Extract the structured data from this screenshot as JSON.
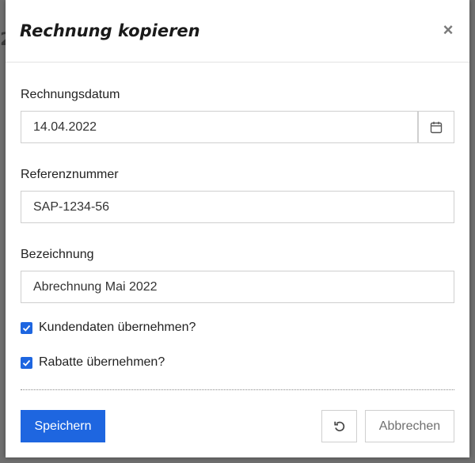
{
  "dialog": {
    "title": "Rechnung kopieren",
    "close_symbol": "×"
  },
  "fields": {
    "invoice_date": {
      "label": "Rechnungsdatum",
      "value": "14.04.2022",
      "icon": "calendar-icon"
    },
    "reference_number": {
      "label": "Referenznummer",
      "value": "SAP-1234-56"
    },
    "description": {
      "label": "Bezeichnung",
      "value": "Abrechnung Mai 2022"
    }
  },
  "checkboxes": [
    {
      "label": "Kundendaten übernehmen?",
      "checked": true
    },
    {
      "label": "Rabatte übernehmen?",
      "checked": true
    }
  ],
  "footer": {
    "save_label": "Speichern",
    "reset_icon": "undo-icon",
    "cancel_label": "Abbrechen"
  },
  "colors": {
    "primary": "#1e66e0",
    "backdrop": "#6f6f6f"
  }
}
